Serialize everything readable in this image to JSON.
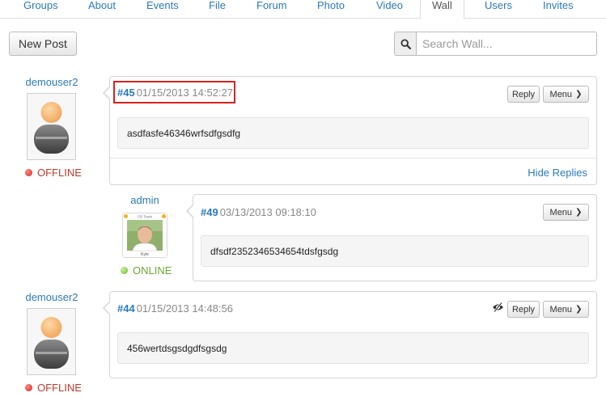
{
  "tabs": [
    {
      "label": "Groups"
    },
    {
      "label": "About"
    },
    {
      "label": "Events"
    },
    {
      "label": "File"
    },
    {
      "label": "Forum"
    },
    {
      "label": "Photo"
    },
    {
      "label": "Video"
    },
    {
      "label": "Wall"
    },
    {
      "label": "Users"
    },
    {
      "label": "Invites"
    }
  ],
  "active_tab": "Wall",
  "toolbar": {
    "new_post_label": "New Post",
    "search_placeholder": "Search Wall...",
    "search_icon": "search-icon"
  },
  "posts": [
    {
      "author": "demouser2",
      "status": "OFFLINE",
      "id": "#45",
      "date": "01/15/2013 14:52:27",
      "body": "asdfasfe46346wrfsdfgsdfg",
      "reply_label": "Reply",
      "menu_label": "Menu",
      "hide_replies_label": "Hide Replies"
    },
    {
      "author": "admin",
      "status": "ONLINE",
      "avatar_caption_top": "CB Team",
      "avatar_caption_bottom": "Kyle",
      "id": "#49",
      "date": "03/13/2013 09:18:10",
      "body": "dfsdf2352346534654tdsfgsdg",
      "menu_label": "Menu"
    },
    {
      "author": "demouser2",
      "status": "OFFLINE",
      "id": "#44",
      "date": "01/15/2013 14:48:56",
      "body": "456wertdsgsdgdfsgsdg",
      "reply_label": "Reply",
      "menu_label": "Menu",
      "extra_icon": "eye-slash-icon"
    }
  ],
  "colors": {
    "link": "#2a7ab9",
    "offline": "#c0392b",
    "online": "#6aa832",
    "highlight": "#d7231b"
  }
}
